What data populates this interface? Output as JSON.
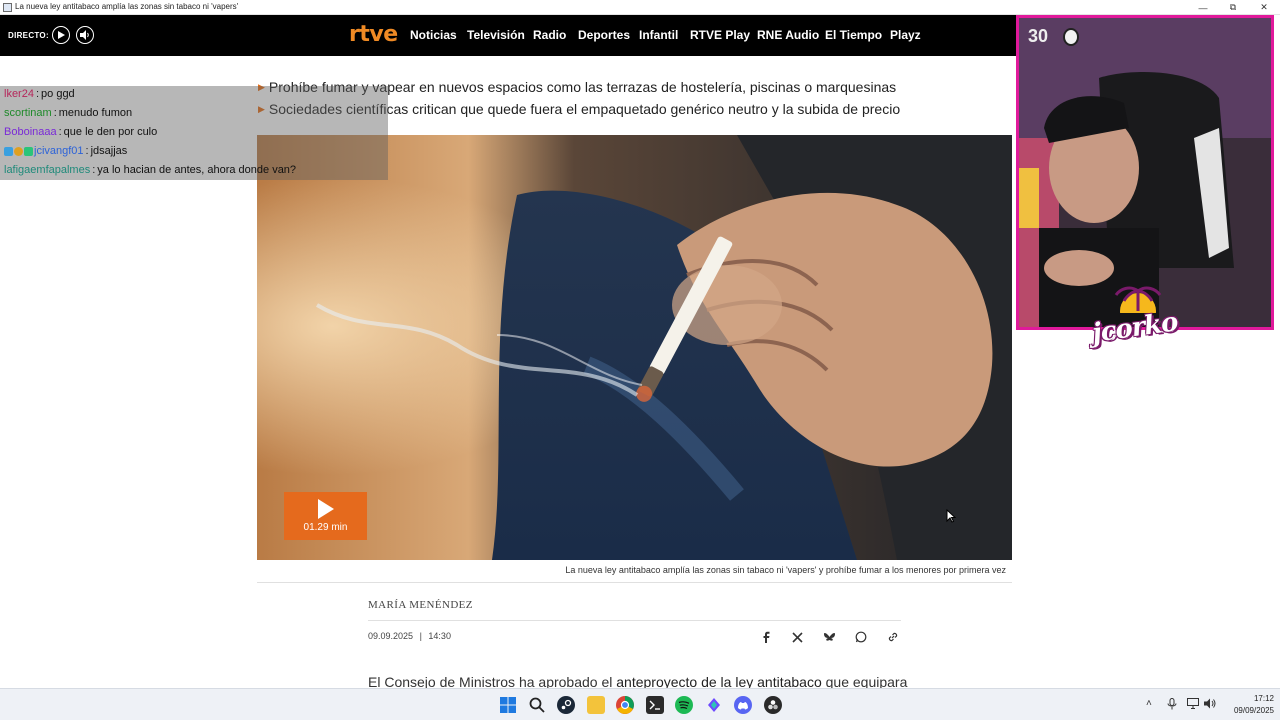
{
  "window": {
    "title": "La nueva ley antitabaco amplía las zonas sin tabaco ni 'vapers'",
    "controls": [
      "minimize-icon",
      "restore-icon",
      "close-icon"
    ]
  },
  "navbar": {
    "directo_label": "DIRECTO:",
    "logo": "rtve",
    "items": [
      "Noticias",
      "Televisión",
      "Radio",
      "Deportes",
      "Infantil",
      "RTVE Play",
      "RNE Audio",
      "El Tiempo",
      "Playz"
    ]
  },
  "chat": {
    "messages": [
      {
        "user": "lker24",
        "text": "po ggd",
        "color": "#b5265a"
      },
      {
        "user": "scortinam",
        "text": "menudo fumon",
        "color": "#1f8a2a"
      },
      {
        "user": "Boboinaaa",
        "text": "que le den por culo",
        "color": "#7a2bd6"
      },
      {
        "user": "jcivangf01",
        "text": "jdsajjas",
        "color": "#2d63d8"
      },
      {
        "user": "lafigaemfapalmes",
        "text": "ya lo hacian de antes, ahora donde van?",
        "color": "#1f8a7a"
      }
    ],
    "separator": ":"
  },
  "article": {
    "bullets": [
      "Prohíbe fumar y vapear en nuevos espacios como las terrazas de hostelería, piscinas o marquesinas",
      "Sociedades científicas critican que quede fuera el empaquetado genérico neutro y la subida de precio"
    ],
    "video_duration": "01.29 min",
    "caption": "La nueva ley antitabaco amplía las zonas sin tabaco ni 'vapers' y prohíbe fumar a los menores por primera vez",
    "author": "MARÍA MENÉNDEZ",
    "date": "09.09.2025",
    "time": "14:30",
    "date_sep": "|",
    "share_icons": [
      "facebook-icon",
      "x-icon",
      "bluesky-icon",
      "whatsapp-icon",
      "link-icon"
    ],
    "body_start": "El Consejo de Ministros ha aprobado el ",
    "body_link": "anteproyecto de la ley antitabaco",
    "body_end": " que equipara"
  },
  "webcam": {
    "count": "30",
    "brand": "jcorko"
  },
  "taskbar": {
    "apps": [
      "windows-start-icon",
      "search-icon",
      "steam-icon",
      "file-explorer-icon",
      "chrome-icon",
      "terminal-icon",
      "spotify-icon",
      "proton-vpn-icon",
      "discord-icon",
      "obs-icon"
    ],
    "clock_time": "17:12",
    "clock_date": "09/09/2025"
  },
  "colors": {
    "accent": "#e56a1d",
    "logo": "#f08a24",
    "webcam_border": "#e0199b"
  }
}
